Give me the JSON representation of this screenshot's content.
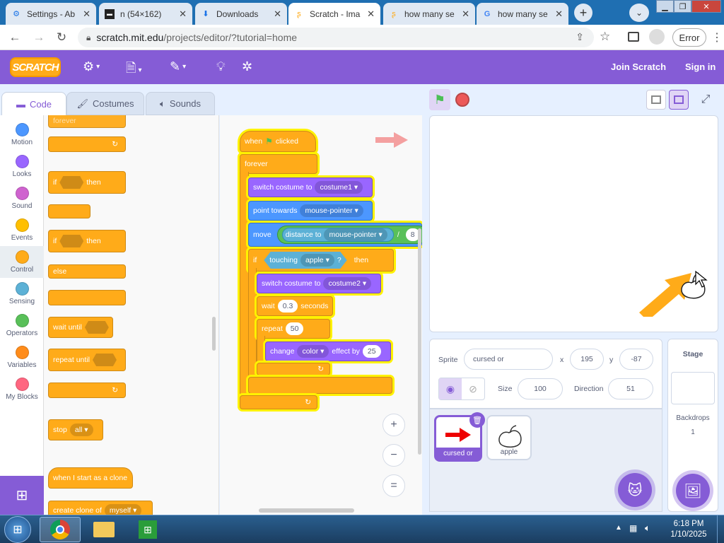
{
  "browser": {
    "tabs": [
      {
        "title": "Settings - Ab",
        "icon": "gear-icon"
      },
      {
        "title": "n (54×162)",
        "icon": "image-icon"
      },
      {
        "title": "Downloads",
        "icon": "download-icon"
      },
      {
        "title": "Scratch - Ima",
        "icon": "scratch-cat-icon"
      },
      {
        "title": "how many se",
        "icon": "scratch-cat-icon"
      },
      {
        "title": "how many se",
        "icon": "google-icon"
      }
    ],
    "url_host": "scratch.mit.edu",
    "url_path": "/projects/editor/?tutorial=home",
    "error_label": "Error"
  },
  "scratch_menu": {
    "logo": "SCRATCH",
    "join": "Join Scratch",
    "signin": "Sign in"
  },
  "editor_tabs": {
    "code": "Code",
    "costumes": "Costumes",
    "sounds": "Sounds"
  },
  "categories": [
    {
      "label": "Motion",
      "color": "#4c97ff"
    },
    {
      "label": "Looks",
      "color": "#9966ff"
    },
    {
      "label": "Sound",
      "color": "#cf63cf"
    },
    {
      "label": "Events",
      "color": "#ffbf00"
    },
    {
      "label": "Control",
      "color": "#ffab19"
    },
    {
      "label": "Sensing",
      "color": "#5cb1d6"
    },
    {
      "label": "Operators",
      "color": "#59c059"
    },
    {
      "label": "Variables",
      "color": "#ff8c1a"
    },
    {
      "label": "My Blocks",
      "color": "#ff6680"
    }
  ],
  "palette": {
    "forever": "forever",
    "if": "if",
    "then": "then",
    "else": "else",
    "wait_until": "wait until",
    "repeat_until": "repeat until",
    "stop": "stop",
    "stop_opt": "all",
    "clone_start": "when I start as a clone",
    "create_clone": "create clone of",
    "clone_opt": "myself"
  },
  "script": {
    "hat": "when",
    "hat_end": "clicked",
    "forever": "forever",
    "switch_costume": "switch costume to",
    "costume1": "costume1",
    "point_towards": "point towards",
    "mouse_pointer": "mouse-pointer",
    "move": "move",
    "distance_to": "distance to",
    "div": "/",
    "div_val": "8",
    "if": "if",
    "touching": "touching",
    "apple": "apple",
    "q": "?",
    "then": "then",
    "costume2": "costume2",
    "wait": "wait",
    "wait_val": "0.3",
    "seconds": "seconds",
    "repeat": "repeat",
    "repeat_val": "50",
    "change": "change",
    "color": "color",
    "effect_by": "effect by",
    "effect_val": "25"
  },
  "zoom": {
    "in": "+",
    "out": "−",
    "reset": "="
  },
  "sprite_info": {
    "sprite_label": "Sprite",
    "sprite_name": "cursed or",
    "x_label": "x",
    "x": "195",
    "y_label": "y",
    "y": "-87",
    "size_label": "Size",
    "size": "100",
    "direction_label": "Direction",
    "direction": "51"
  },
  "sprites": [
    {
      "name": "cursed or",
      "selected": true
    },
    {
      "name": "apple",
      "selected": false
    }
  ],
  "stage_pane": {
    "title": "Stage",
    "backdrops_label": "Backdrops",
    "backdrops_count": "1"
  },
  "taskbar": {
    "time": "6:18 PM",
    "date": "1/10/2025"
  }
}
